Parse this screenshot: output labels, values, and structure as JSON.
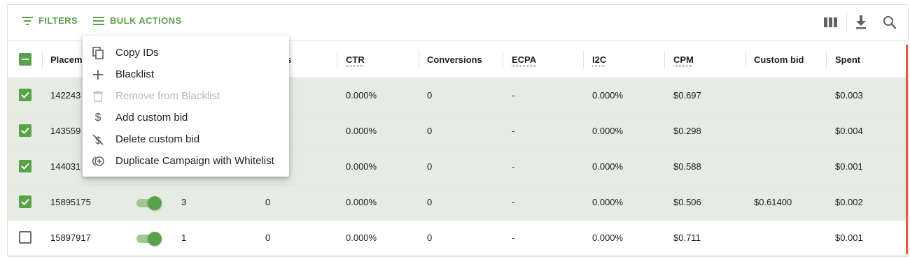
{
  "toolbar": {
    "filters_label": "FILTERS",
    "bulk_actions_label": "BULK ACTIONS",
    "accent_color": "#5aa24a"
  },
  "menu": {
    "items": [
      {
        "label": "Copy IDs",
        "icon": "copy-icon",
        "disabled": false
      },
      {
        "label": "Blacklist",
        "icon": "plus-icon",
        "disabled": false
      },
      {
        "label": "Remove from Blacklist",
        "icon": "trash-icon",
        "disabled": true
      },
      {
        "label": "Add custom bid",
        "icon": "dollar-icon",
        "disabled": false
      },
      {
        "label": "Delete custom bid",
        "icon": "dollar-off-icon",
        "disabled": false
      },
      {
        "label": "Duplicate Campaign with Whitelist",
        "icon": "duplicate-plus-icon",
        "disabled": false
      }
    ]
  },
  "table": {
    "headers": {
      "placement": "Placem",
      "col3_tail": "s",
      "ctr": "CTR",
      "conversions": "Conversions",
      "ecpa": "ECPA",
      "i2c": "I2C",
      "cpm": "CPM",
      "custom_bid": "Custom bid",
      "spent": "Spent"
    },
    "rows": [
      {
        "id": "142243",
        "selected": true,
        "c3": "",
        "c4": "",
        "ctr": "0.000%",
        "conversions": "0",
        "ecpa": "-",
        "i2c": "0.000%",
        "cpm": "$0.697",
        "custom_bid": "",
        "spent": "$0.003"
      },
      {
        "id": "143559",
        "selected": true,
        "c3": "",
        "c4": "",
        "ctr": "0.000%",
        "conversions": "0",
        "ecpa": "-",
        "i2c": "0.000%",
        "cpm": "$0.298",
        "custom_bid": "",
        "spent": "$0.004"
      },
      {
        "id": "144031",
        "selected": true,
        "c3": "",
        "c4": "",
        "ctr": "0.000%",
        "conversions": "0",
        "ecpa": "-",
        "i2c": "0.000%",
        "cpm": "$0.588",
        "custom_bid": "",
        "spent": "$0.001"
      },
      {
        "id": "15895175",
        "selected": true,
        "c3": "3",
        "c4": "0",
        "ctr": "0.000%",
        "conversions": "0",
        "ecpa": "-",
        "i2c": "0.000%",
        "cpm": "$0.506",
        "custom_bid": "$0.61400",
        "spent": "$0.002"
      },
      {
        "id": "15897917",
        "selected": false,
        "c3": "1",
        "c4": "0",
        "ctr": "0.000%",
        "conversions": "0",
        "ecpa": "-",
        "i2c": "0.000%",
        "cpm": "$0.711",
        "custom_bid": "",
        "spent": "$0.001"
      }
    ]
  }
}
